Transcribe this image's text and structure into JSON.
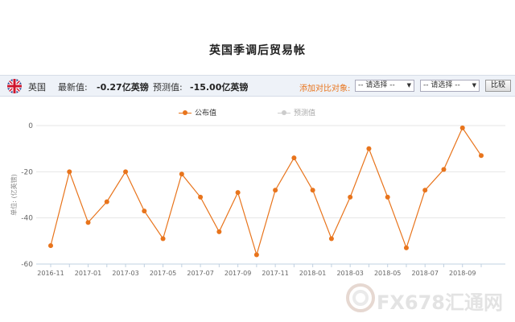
{
  "page": {
    "title": "英国季调后贸易帐"
  },
  "info_bar": {
    "country": "英国",
    "latest_label": "最新值:",
    "latest_value": "-0.27亿英镑",
    "forecast_label": "预测值:",
    "forecast_value": "-15.00亿英镑",
    "compare_label": "添加对比对象:",
    "select1": "-- 请选择 --",
    "select2": "-- 请选择 --",
    "compare_button": "比较"
  },
  "colors": {
    "series": "#e8741c",
    "forecast": "#bbbbbb",
    "compare_label": "#e8741c"
  },
  "icons": {
    "flag": "uk-flag-icon"
  },
  "watermark": {
    "text": "FX678汇通网"
  },
  "chart_data": {
    "type": "line",
    "ylabel": "单位: (亿英镑)",
    "ylim": [
      -60,
      0
    ],
    "yticks": [
      0,
      -20,
      -40,
      -60
    ],
    "ytick_labels": [
      "0",
      "-20",
      "-40",
      "-60"
    ],
    "x": [
      "2016-11",
      "2016-12",
      "2017-01",
      "2017-02",
      "2017-03",
      "2017-04",
      "2017-05",
      "2017-06",
      "2017-07",
      "2017-08",
      "2017-09",
      "2017-10",
      "2017-11",
      "2017-12",
      "2018-01",
      "2018-02",
      "2018-03",
      "2018-04",
      "2018-05",
      "2018-06",
      "2018-07",
      "2018-08",
      "2018-09",
      "2018-10"
    ],
    "xtick_labels": [
      "2016-11",
      "2017-01",
      "2017-03",
      "2017-05",
      "2017-07",
      "2017-09",
      "2017-11",
      "2018-01",
      "2018-03",
      "2018-05",
      "2018-07",
      "2018-09"
    ],
    "legend": "top",
    "grid": true,
    "series": [
      {
        "name": "公布值",
        "values": [
          -52,
          -20,
          -42,
          -33,
          -20,
          -37,
          -49,
          -21,
          -31,
          -46,
          -29,
          -56,
          -28,
          -14,
          -28,
          -49,
          -31,
          -10,
          -31,
          -53,
          -28,
          -19,
          -1,
          -13
        ]
      },
      {
        "name": "预测值",
        "values": []
      }
    ]
  }
}
